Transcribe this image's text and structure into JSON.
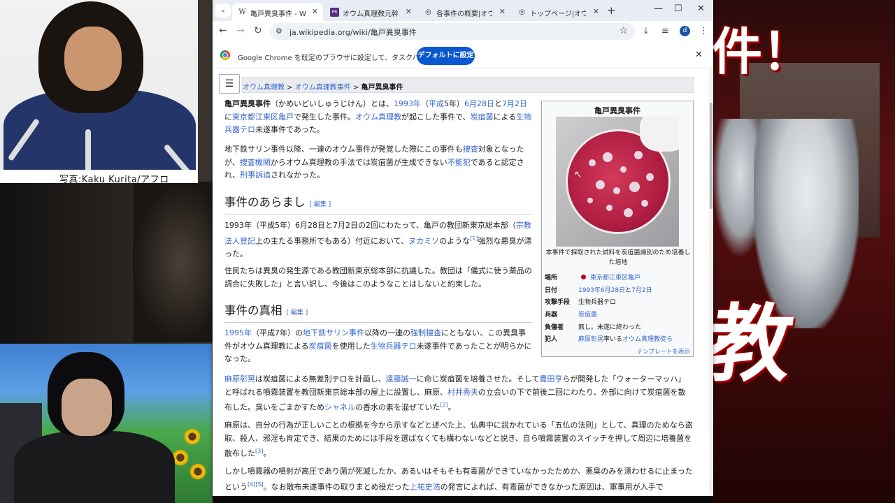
{
  "overlay": {
    "photo_caption": "写真:Kaku Kurita/アフロ",
    "bg_text_top": "件！",
    "bg_text_bottom": "教"
  },
  "browser": {
    "tabs": [
      {
        "icon": "W",
        "label": "亀戸異臭事件 - Wikipe",
        "active": true
      },
      {
        "icon": "PR",
        "label": "オウム真理教元幹部, 死",
        "active": false
      },
      {
        "icon": "◎",
        "label": "各事件の概要|オウム真",
        "active": false
      },
      {
        "icon": "◎",
        "label": "トップページ|オウム真理教",
        "active": false
      }
    ],
    "url": "ja.wikipedia.org/wiki/亀戸異臭事件",
    "profile_initial": "d",
    "infobar": {
      "message": "Google Chrome を既定のブラウザに設定して、タスクバーに固定する",
      "button": "デフォルトに設定"
    }
  },
  "article": {
    "breadcrumb": {
      "part1": "オウム真理教",
      "sep": " > ",
      "part2": "オウム真理教事件",
      "current": "亀戸異臭事件"
    },
    "intro": {
      "title_bold": "亀戸異臭事件",
      "reading": "（かめいどいしゅうじけん）とは、",
      "date_link1": "1993年",
      "paren_open": "（",
      "era_link": "平成",
      "era_rest": "5年）",
      "date_link2": "6月28日",
      "and": "と",
      "date_link3": "7月2日",
      "ni": "に",
      "place_link": "東京都江東区亀戸",
      "occurred": "で発生した事件。",
      "cult_link": "オウム真理教",
      "cause": "が起こした事件で、",
      "anthrax_link": "炭疽菌",
      "by": "による",
      "bio_link": "生物兵器テロ",
      "attempt": "未遂事件であった。"
    },
    "para2": {
      "t1": "地下鉄サリン事件以降、一連のオウム事件が発覚した際にこの事件も",
      "link1": "捜査",
      "t2": "対象となったが、",
      "link2": "捜査機関",
      "t3": "からオウム真理教の手法では炭疽菌が生成できない",
      "link3": "不能犯",
      "t4": "であると認定され、",
      "link4": "刑事訴追",
      "t5": "されなかった。"
    },
    "h_outline": "事件のあらまし",
    "edit_label": "[ 編集 ]",
    "outline1": {
      "t1": "1993年（平成5年）6月28日と7月2日の2回にわたって、亀戸の教団新東京総本部（",
      "link1": "宗教法人登記",
      "t2": "上の主たる事務所でもある）付近において、",
      "link2": "ヌカミソ",
      "t3": "のような",
      "ref1": "[1]",
      "t4": "強烈な悪臭が漂った。"
    },
    "outline2": "住民たちは異臭の発生源である教団新東京総本部に抗議した。教団は「儀式に使う薬品の調合に失敗した」と言い訳し、今後はこのようなことはしないと約束した。",
    "h_truth": "事件の真相",
    "truth1": {
      "link1": "1995年",
      "t1": "（平成7年）の",
      "link2": "地下鉄サリン事件",
      "t2": "以降の一連の",
      "link3": "強制捜査",
      "t3": "にともない、この異臭事件がオウム真理教による",
      "link4": "炭疽菌",
      "t4": "を使用した",
      "link5": "生物兵器テロ",
      "t5": "未遂事件であったことが明らかになった。"
    },
    "truth2": {
      "link1": "麻原彰晃",
      "t1": "は炭疽菌による無差別テロを計画し、",
      "link2": "遠藤誠一",
      "t2": "に命じ炭疽菌を培養させた。そして",
      "link3": "豊田亨",
      "t3": "らが開発した「ウォーターマッハ」と呼ばれる噴霧装置を教団新東京総本部の屋上に設置し、麻原、",
      "link4": "村井秀夫",
      "t4": "の立会いの下で前後二回にわたり、外部に向けて炭疽菌を散布した。臭いをごまかすため",
      "link5": "シャネル",
      "t5": "の香水の素を混ぜ",
      "t6": "ていた",
      "ref": "[2]",
      "end": "。"
    },
    "truth3": {
      "t1": "麻原は、自分の行為が正しいことの根拠を今から示すなどと述べた上、仏典中に説かれている「五仏の法則」として、真理のためなら盗取、殺人、邪淫も肯定でき、結果のためには手段を選ばなくても構わないなどと説き、自ら噴霧装置のスイッチを押して周辺に培養菌を散布した",
      "ref": "[3]",
      "end": "。"
    },
    "truth4": {
      "t1": "しかし噴霧器の噴射が高圧であり菌が死滅したか、あるいはそもそも有毒菌ができていなかったためか、悪臭のみを漂わせるに止まったという",
      "ref": "[4][5]",
      "t2": "。なお散布未遂事件の取りまとめ役だった",
      "link1": "上祐史浩",
      "t3": "の発言によれば、有毒菌ができなかった原因は、軍事用が入手で"
    }
  },
  "infobox": {
    "title": "亀戸異臭事件",
    "caption": "本事件で採取された試料を炭疽菌識別のため培養した培地",
    "rows": {
      "place_k": "場所",
      "place_v": "東京都江東区亀戸",
      "date_k": "日付",
      "date_v1": "1993年6月28日",
      "date_and": "と",
      "date_v2": "7月2日",
      "method_k": "攻撃手段",
      "method_v": "生物兵器テロ",
      "weapon_k": "兵器",
      "weapon_v": "炭疽菌",
      "injured_k": "負傷者",
      "injured_v": "無し。未遂に終わった",
      "culprit_k": "犯人",
      "culprit_v1": "麻原彰晃",
      "culprit_mid": "率いる",
      "culprit_v2": "オウム真理教徒ら"
    },
    "template_link": "テンプレートを表示"
  }
}
